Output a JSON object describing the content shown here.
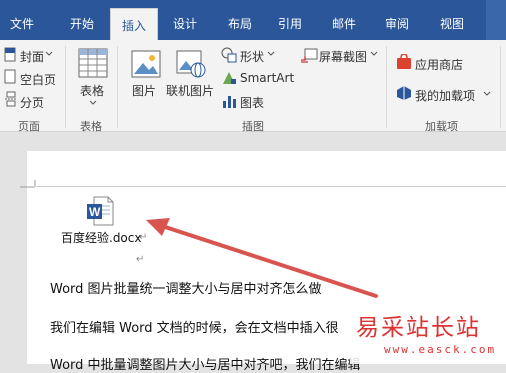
{
  "tabs": [
    {
      "label": "文件"
    },
    {
      "label": "开始"
    },
    {
      "label": "插入"
    },
    {
      "label": "设计"
    },
    {
      "label": "布局"
    },
    {
      "label": "引用"
    },
    {
      "label": "邮件"
    },
    {
      "label": "审阅"
    },
    {
      "label": "视图"
    }
  ],
  "ribbon": {
    "pages_group": {
      "cover": "封面",
      "blank": "空白页",
      "break": "分页",
      "label": "页面"
    },
    "tables_group": {
      "table": "表格",
      "label": "表格"
    },
    "illustrations_group": {
      "picture": "图片",
      "online_picture": "联机图片",
      "shapes": "形状",
      "smartart": "SmartArt",
      "chart": "图表",
      "screenshot": "屏幕截图",
      "label": "插图"
    },
    "addins_group": {
      "store": "应用商店",
      "my_addins": "我的加载项",
      "label": "加载项"
    }
  },
  "document": {
    "file_name": "百度经验.docx",
    "line1": "Word 图片批量统一调整大小与居中对齐怎么做",
    "line2": "我们在编辑 Word 文档的时候，会在文档中插入很",
    "line3": "Word 中批量调整图片大小与居中对齐吧，我们在编辑"
  },
  "watermark": {
    "text": "易采站长站",
    "url": "www.easck.com"
  },
  "colors": {
    "accent": "#2b579a",
    "arrow": "#d9534f",
    "watermark": "#dd3333"
  }
}
